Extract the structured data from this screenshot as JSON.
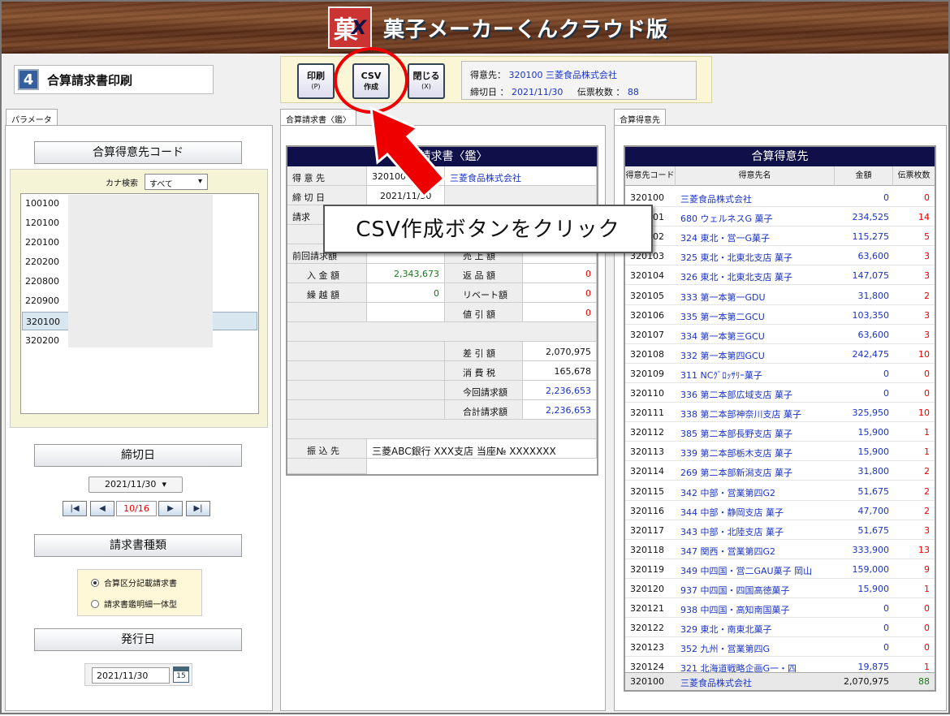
{
  "app": {
    "title": "菓子メーカーくんクラウド版",
    "logo_text": "菓",
    "logo_accent": "X"
  },
  "screen": {
    "number": "4",
    "title": "合算請求書印刷"
  },
  "toolbar": {
    "print_label": "印刷",
    "print_key": "(P)",
    "csv_label": "CSV",
    "csv_sub": "作成",
    "close_label": "閉じる",
    "close_key": "(X)"
  },
  "info": {
    "customer_label": "得意先：",
    "customer_code": "320100",
    "customer_name": "三菱食品株式会社",
    "cutoff_label": "締切日 ：",
    "cutoff_date": "2021/11/30",
    "slips_label": "伝票枚数 ：",
    "slips_count": "88"
  },
  "tabs": {
    "params": "パラメータ",
    "invoice": "合算請求書〈鑑〉",
    "customers": "合算得意先"
  },
  "params": {
    "code_heading": "合算得意先コード",
    "kana_label": "カナ検索",
    "kana_value": "すべて",
    "codes": [
      "100100",
      "120100",
      "220100",
      "220200",
      "220800",
      "220900",
      "320100",
      "320200"
    ],
    "cutoff_heading": "締切日",
    "cutoff_value": "2021/11/30",
    "page_indicator": "10/16",
    "type_heading": "請求書種類",
    "type_options": [
      "合算区分記載請求書",
      "請求書鑑明細一体型"
    ],
    "issue_heading": "発行日",
    "issue_value": "2021/11/30",
    "cal_glyph": "15"
  },
  "invoice": {
    "heading": "合算請求書〈鑑〉",
    "tokuisaki_label": "得 意 先",
    "tokuisaki_code": "320100",
    "tokuisaki_name": "三菱食品株式会社",
    "shimekiri_label": "締 切 日",
    "shimekiri_value": "2021/11/30",
    "seikyu_label": "請求",
    "zenkai_label": "前回請求額",
    "uriage_label": "売 上 額",
    "nyukin_label": "入 金 額",
    "nyukin_value": "2,343,673",
    "henpin_label": "返 品 額",
    "henpin_value": "0",
    "kurikoshi_label": "繰 越 額",
    "kurikoshi_value": "0",
    "rebate_label": "リベート額",
    "rebate_value": "0",
    "nebiki_label": "値 引 額",
    "nebiki_value": "0",
    "sashihiki_label": "差 引 額",
    "sashihiki_value": "2,070,975",
    "shohizei_label": "消 費 税",
    "shohizei_value": "165,678",
    "konkai_label": "今回請求額",
    "konkai_value": "2,236,653",
    "gokei_label": "合計請求額",
    "gokei_value": "2,236,653",
    "furikomi_label": "振 込 先",
    "furikomi_value": "三菱ABC銀行 XXX支店 当座№ XXXXXXX"
  },
  "customers": {
    "heading": "合算得意先",
    "columns": [
      "得意先コード",
      "得意先名",
      "金額",
      "伝票枚数"
    ],
    "rows": [
      {
        "code": "320100",
        "name": "三菱食品株式会社",
        "amount": "0",
        "count": "0"
      },
      {
        "code": "320101",
        "name": "680 ウェルネスG 菓子",
        "amount": "234,525",
        "count": "14"
      },
      {
        "code": "320102",
        "name": "324 東北・営一G菓子",
        "amount": "115,275",
        "count": "5"
      },
      {
        "code": "320103",
        "name": "325 東北・北東北支店 菓子",
        "amount": "63,600",
        "count": "3"
      },
      {
        "code": "320104",
        "name": "326 東北・北東北支店 菓子",
        "amount": "147,075",
        "count": "3"
      },
      {
        "code": "320105",
        "name": "333 第一本第一GDU",
        "amount": "31,800",
        "count": "2"
      },
      {
        "code": "320106",
        "name": "335 第一本第二GCU",
        "amount": "103,350",
        "count": "3"
      },
      {
        "code": "320107",
        "name": "334 第一本第三GCU",
        "amount": "63,600",
        "count": "3"
      },
      {
        "code": "320108",
        "name": "332 第一本第四GCU",
        "amount": "242,475",
        "count": "10"
      },
      {
        "code": "320109",
        "name": "311 NCｸﾞﾛｯｻﾘｰ菓子",
        "amount": "0",
        "count": "0"
      },
      {
        "code": "320110",
        "name": "336 第二本部広域支店 菓子",
        "amount": "0",
        "count": "0"
      },
      {
        "code": "320111",
        "name": "338 第二本部神奈川支店 菓子",
        "amount": "325,950",
        "count": "10"
      },
      {
        "code": "320112",
        "name": "385 第二本部長野支店 菓子",
        "amount": "15,900",
        "count": "1"
      },
      {
        "code": "320113",
        "name": "339 第二本部栃木支店 菓子",
        "amount": "15,900",
        "count": "1"
      },
      {
        "code": "320114",
        "name": "269 第二本部新潟支店 菓子",
        "amount": "31,800",
        "count": "2"
      },
      {
        "code": "320115",
        "name": "342 中部・営業第四G2",
        "amount": "51,675",
        "count": "2"
      },
      {
        "code": "320116",
        "name": "344 中部・静岡支店 菓子",
        "amount": "47,700",
        "count": "2"
      },
      {
        "code": "320117",
        "name": "343 中部・北陸支店 菓子",
        "amount": "51,675",
        "count": "3"
      },
      {
        "code": "320118",
        "name": "347 関西・営業第四G2",
        "amount": "333,900",
        "count": "13"
      },
      {
        "code": "320119",
        "name": "349 中四国・営二GAU菓子 岡山",
        "amount": "159,000",
        "count": "9"
      },
      {
        "code": "320120",
        "name": "937 中四国・四国高徳菓子",
        "amount": "15,900",
        "count": "1"
      },
      {
        "code": "320121",
        "name": "938 中四国・高知南国菓子",
        "amount": "0",
        "count": "0"
      },
      {
        "code": "320122",
        "name": "329 東北・南東北菓子",
        "amount": "0",
        "count": "0"
      },
      {
        "code": "320123",
        "name": "352 九州・営業第四G",
        "amount": "0",
        "count": "0"
      },
      {
        "code": "320124",
        "name": "321 北海道戦略企画G一・四",
        "amount": "19,875",
        "count": "1"
      }
    ],
    "total": {
      "code": "320100",
      "name": "三菱食品株式会社",
      "amount": "2,070,975",
      "count": "88"
    }
  },
  "callout": {
    "text": "CSV作成ボタンをクリック",
    "color": "#e00000"
  }
}
